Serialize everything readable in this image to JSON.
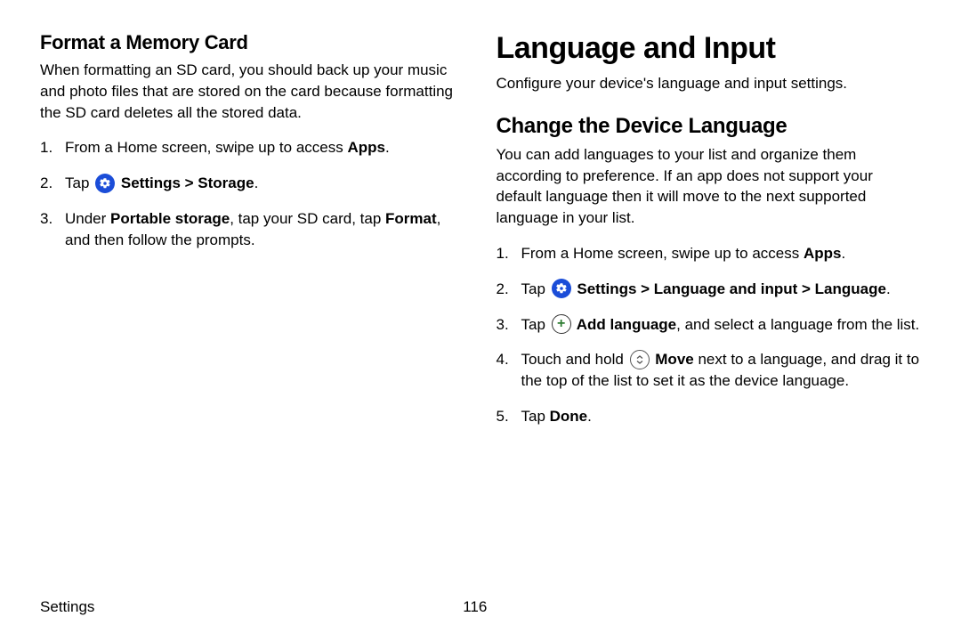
{
  "left": {
    "heading": "Format a Memory Card",
    "intro": "When formatting an SD card, you should back up your music and photo files that are stored on the card because formatting the SD card deletes all the stored data.",
    "steps": {
      "s1_pre": "From a Home screen, swipe up to access ",
      "s1_bold": "Apps",
      "s1_post": ".",
      "s2_pre": "Tap ",
      "s2_bold": " Settings > Storage",
      "s2_post": ".",
      "s3_pre": "Under ",
      "s3_bold1": "Portable storage",
      "s3_mid": ", tap your SD card, tap ",
      "s3_bold2": "Format",
      "s3_post": ", and then follow the prompts."
    }
  },
  "right": {
    "title": "Language and Input",
    "intro": "Configure your device's language and input settings.",
    "section_heading": "Change the Device Language",
    "section_intro": "You can add languages to your list and organize them according to preference. If an app does not support your default language then it will move to the next supported language in your list.",
    "steps": {
      "s1_pre": "From a Home screen, swipe up to access ",
      "s1_bold": "Apps",
      "s1_post": ".",
      "s2_pre": "Tap ",
      "s2_bold": " Settings > Language and input > Language",
      "s2_post": ".",
      "s3_pre": "Tap ",
      "s3_bold": " Add language",
      "s3_post": ", and select a language from the list.",
      "s4_pre": "Touch and hold ",
      "s4_bold": " Move",
      "s4_post": " next to a language, and drag it to the top of the list to set it as the device language.",
      "s5_pre": "Tap ",
      "s5_bold": "Done",
      "s5_post": "."
    }
  },
  "footer": {
    "label": "Settings",
    "page": "116"
  }
}
